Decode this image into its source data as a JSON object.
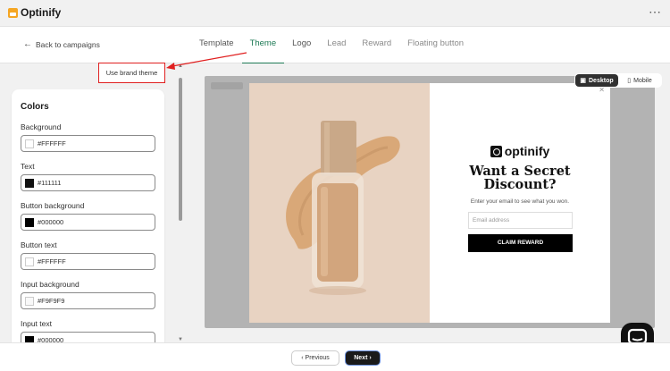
{
  "app": {
    "title": "Optinify",
    "more_icon": "more-horizontal-icon"
  },
  "header": {
    "back_label": "Back to campaigns",
    "tabs": [
      {
        "label": "Template"
      },
      {
        "label": "Theme"
      },
      {
        "label": "Logo"
      },
      {
        "label": "Lead"
      },
      {
        "label": "Reward"
      },
      {
        "label": "Floating button"
      }
    ],
    "active_tab": "Theme"
  },
  "brand_theme_button": "Use brand theme",
  "colors_panel": {
    "title": "Colors",
    "fields": [
      {
        "label": "Background",
        "value": "#FFFFFF",
        "swatch": "#FFFFFF"
      },
      {
        "label": "Text",
        "value": "#111111",
        "swatch": "#111111"
      },
      {
        "label": "Button background",
        "value": "#000000",
        "swatch": "#000000"
      },
      {
        "label": "Button text",
        "value": "#FFFFFF",
        "swatch": "#FFFFFF"
      },
      {
        "label": "Input background",
        "value": "#F9F9F9",
        "swatch": "#F9F9F9"
      },
      {
        "label": "Input text",
        "value": "#000000",
        "swatch": "#000000"
      }
    ]
  },
  "device_toggle": {
    "desktop": "Desktop",
    "mobile": "Mobile",
    "selected": "Desktop"
  },
  "popup": {
    "brand": "optinify",
    "headline_line1": "Want a Secret",
    "headline_line2": "Discount?",
    "subtext": "Enter your email to see what you won.",
    "email_placeholder": "Email address",
    "cta": "CLAIM REWARD"
  },
  "footer": {
    "previous": "Previous",
    "next": "Next"
  }
}
